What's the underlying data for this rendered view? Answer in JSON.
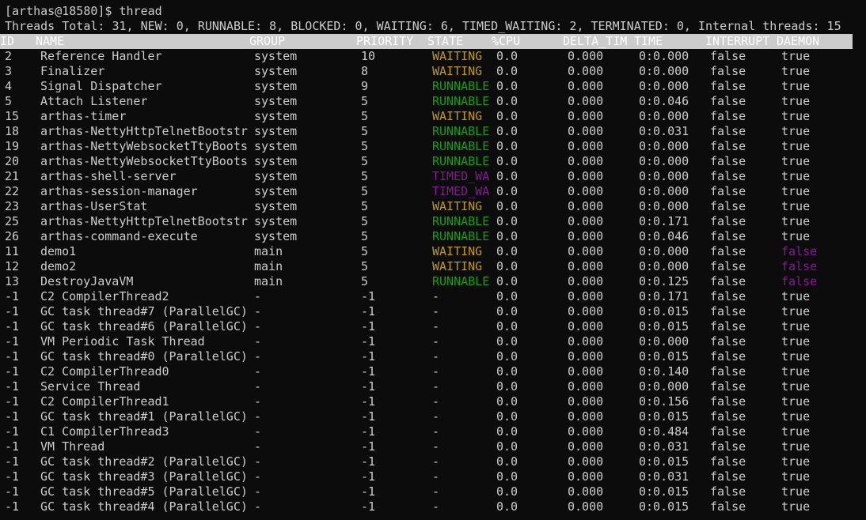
{
  "prompt": "[arthas@18580]$ thread",
  "summary": "Threads Total: 31, NEW: 0, RUNNABLE: 8, BLOCKED: 0, WAITING: 6, TIMED_WAITING: 2, TERMINATED: 0, Internal threads: 15",
  "colors": {
    "background": "#0c0c0c",
    "text": "#cccccc",
    "waiting": "#c19c00",
    "runnable": "#13a10e",
    "timed_waiting": "#881798",
    "header_bg": "#cccccc"
  },
  "columns": [
    "ID",
    "NAME",
    "GROUP",
    "PRIORITY",
    "STATE",
    "%CPU",
    "DELTA_TIM",
    "TIME",
    "INTERRUPT",
    "DAEMON"
  ],
  "rows": [
    [
      "2",
      "Reference Handler",
      "system",
      "10",
      "WAITING",
      "0.0",
      "0.000",
      "0:0.000",
      "false",
      "true"
    ],
    [
      "3",
      "Finalizer",
      "system",
      "8",
      "WAITING",
      "0.0",
      "0.000",
      "0:0.000",
      "false",
      "true"
    ],
    [
      "4",
      "Signal Dispatcher",
      "system",
      "9",
      "RUNNABLE",
      "0.0",
      "0.000",
      "0:0.000",
      "false",
      "true"
    ],
    [
      "5",
      "Attach Listener",
      "system",
      "5",
      "RUNNABLE",
      "0.0",
      "0.000",
      "0:0.046",
      "false",
      "true"
    ],
    [
      "15",
      "arthas-timer",
      "system",
      "5",
      "WAITING",
      "0.0",
      "0.000",
      "0:0.000",
      "false",
      "true"
    ],
    [
      "18",
      "arthas-NettyHttpTelnetBootstr",
      "system",
      "5",
      "RUNNABLE",
      "0.0",
      "0.000",
      "0:0.031",
      "false",
      "true"
    ],
    [
      "19",
      "arthas-NettyWebsocketTtyBoots",
      "system",
      "5",
      "RUNNABLE",
      "0.0",
      "0.000",
      "0:0.000",
      "false",
      "true"
    ],
    [
      "20",
      "arthas-NettyWebsocketTtyBoots",
      "system",
      "5",
      "RUNNABLE",
      "0.0",
      "0.000",
      "0:0.000",
      "false",
      "true"
    ],
    [
      "21",
      "arthas-shell-server",
      "system",
      "5",
      "TIMED_WA",
      "0.0",
      "0.000",
      "0:0.000",
      "false",
      "true"
    ],
    [
      "22",
      "arthas-session-manager",
      "system",
      "5",
      "TIMED_WA",
      "0.0",
      "0.000",
      "0:0.000",
      "false",
      "true"
    ],
    [
      "23",
      "arthas-UserStat",
      "system",
      "5",
      "WAITING",
      "0.0",
      "0.000",
      "0:0.000",
      "false",
      "true"
    ],
    [
      "25",
      "arthas-NettyHttpTelnetBootstr",
      "system",
      "5",
      "RUNNABLE",
      "0.0",
      "0.000",
      "0:0.171",
      "false",
      "true"
    ],
    [
      "26",
      "arthas-command-execute",
      "system",
      "5",
      "RUNNABLE",
      "0.0",
      "0.000",
      "0:0.046",
      "false",
      "true"
    ],
    [
      "11",
      "demo1",
      "main",
      "5",
      "WAITING",
      "0.0",
      "0.000",
      "0:0.000",
      "false",
      "false"
    ],
    [
      "12",
      "demo2",
      "main",
      "5",
      "WAITING",
      "0.0",
      "0.000",
      "0:0.000",
      "false",
      "false"
    ],
    [
      "13",
      "DestroyJavaVM",
      "main",
      "5",
      "RUNNABLE",
      "0.0",
      "0.000",
      "0:0.125",
      "false",
      "false"
    ],
    [
      "-1",
      "C2 CompilerThread2",
      "-",
      "-1",
      "-",
      "0.0",
      "0.000",
      "0:0.171",
      "false",
      "true"
    ],
    [
      "-1",
      "GC task thread#7 (ParallelGC)",
      "-",
      "-1",
      "-",
      "0.0",
      "0.000",
      "0:0.015",
      "false",
      "true"
    ],
    [
      "-1",
      "GC task thread#6 (ParallelGC)",
      "-",
      "-1",
      "-",
      "0.0",
      "0.000",
      "0:0.015",
      "false",
      "true"
    ],
    [
      "-1",
      "VM Periodic Task Thread",
      "-",
      "-1",
      "-",
      "0.0",
      "0.000",
      "0:0.000",
      "false",
      "true"
    ],
    [
      "-1",
      "GC task thread#0 (ParallelGC)",
      "-",
      "-1",
      "-",
      "0.0",
      "0.000",
      "0:0.015",
      "false",
      "true"
    ],
    [
      "-1",
      "C2 CompilerThread0",
      "-",
      "-1",
      "-",
      "0.0",
      "0.000",
      "0:0.140",
      "false",
      "true"
    ],
    [
      "-1",
      "Service Thread",
      "-",
      "-1",
      "-",
      "0.0",
      "0.000",
      "0:0.000",
      "false",
      "true"
    ],
    [
      "-1",
      "C2 CompilerThread1",
      "-",
      "-1",
      "-",
      "0.0",
      "0.000",
      "0:0.156",
      "false",
      "true"
    ],
    [
      "-1",
      "GC task thread#1 (ParallelGC)",
      "-",
      "-1",
      "-",
      "0.0",
      "0.000",
      "0:0.015",
      "false",
      "true"
    ],
    [
      "-1",
      "C1 CompilerThread3",
      "-",
      "-1",
      "-",
      "0.0",
      "0.000",
      "0:0.484",
      "false",
      "true"
    ],
    [
      "-1",
      "VM Thread",
      "-",
      "-1",
      "-",
      "0.0",
      "0.000",
      "0:0.031",
      "false",
      "true"
    ],
    [
      "-1",
      "GC task thread#2 (ParallelGC)",
      "-",
      "-1",
      "-",
      "0.0",
      "0.000",
      "0:0.015",
      "false",
      "true"
    ],
    [
      "-1",
      "GC task thread#3 (ParallelGC)",
      "-",
      "-1",
      "-",
      "0.0",
      "0.000",
      "0:0.031",
      "false",
      "true"
    ],
    [
      "-1",
      "GC task thread#5 (ParallelGC)",
      "-",
      "-1",
      "-",
      "0.0",
      "0.000",
      "0:0.015",
      "false",
      "true"
    ],
    [
      "-1",
      "GC task thread#4 (ParallelGC)",
      "-",
      "-1",
      "-",
      "0.0",
      "0.000",
      "0:0.015",
      "false",
      "true"
    ]
  ]
}
